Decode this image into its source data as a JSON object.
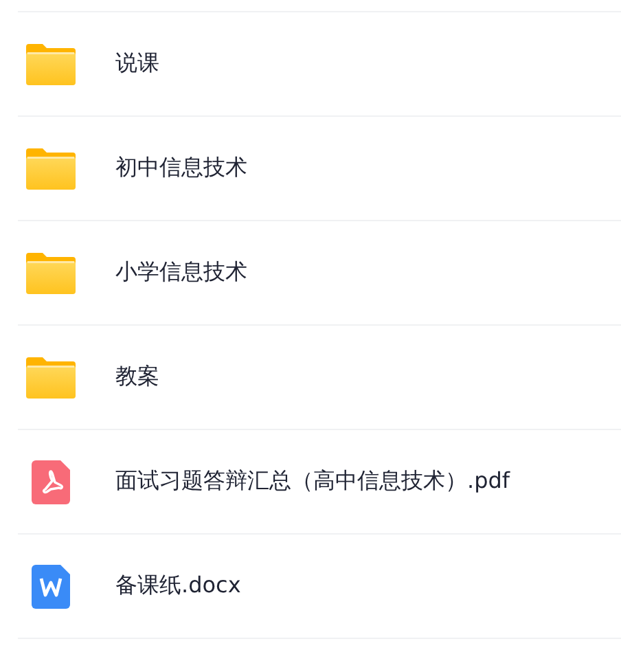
{
  "files": [
    {
      "kind": "folder",
      "name": "说课"
    },
    {
      "kind": "folder",
      "name": "初中信息技术"
    },
    {
      "kind": "folder",
      "name": "小学信息技术"
    },
    {
      "kind": "folder",
      "name": "教案"
    },
    {
      "kind": "pdf",
      "name": "面试习题答辩汇总（高中信息技术）.pdf"
    },
    {
      "kind": "doc",
      "name": "备课纸.docx"
    }
  ]
}
